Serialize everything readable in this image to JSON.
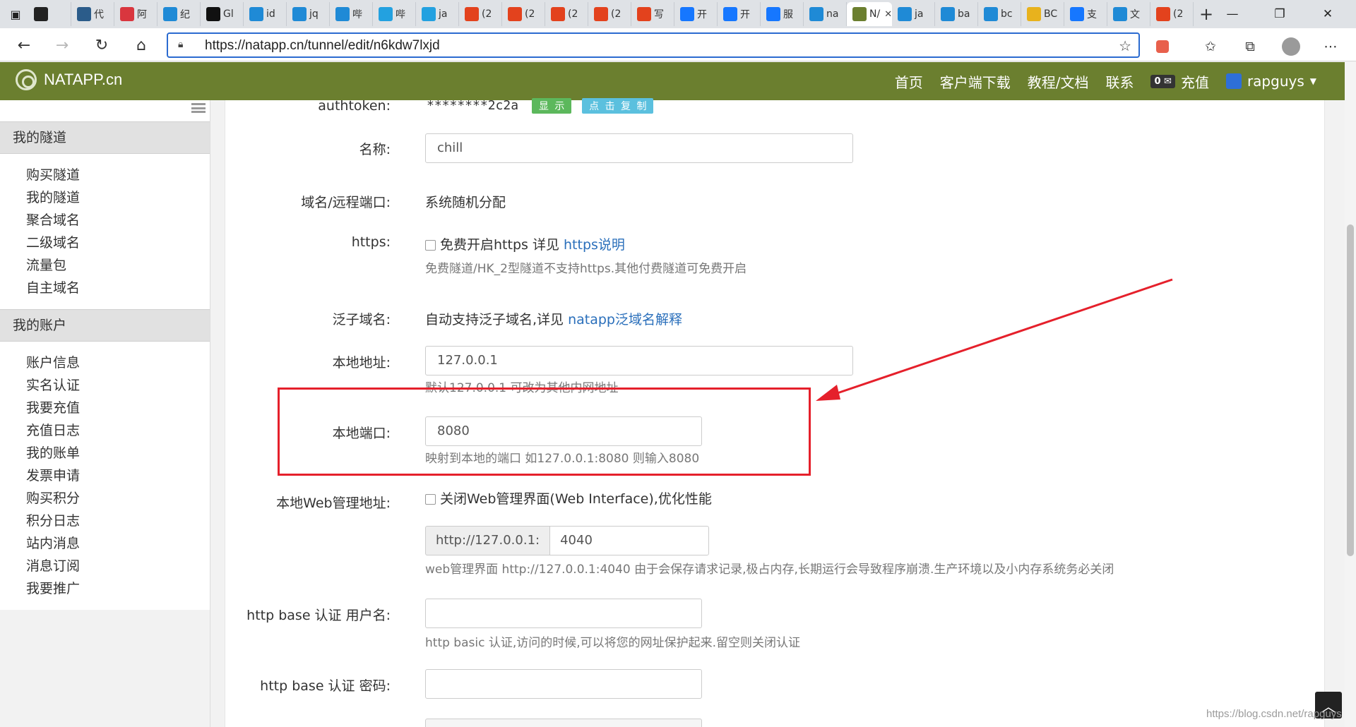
{
  "browser": {
    "tabs": [
      {
        "icon": "edge-icon",
        "label": "",
        "color": "#222222"
      },
      {
        "icon": "bird-icon",
        "label": "代",
        "color": "#2b5c8a"
      },
      {
        "icon": "pdf-icon",
        "label": "阿",
        "color": "#d9363e"
      },
      {
        "icon": "bing-icon",
        "label": "纪",
        "color": "#1f8ad6"
      },
      {
        "icon": "windows-icon",
        "label": "Gl",
        "color": "#111111"
      },
      {
        "icon": "bing-icon",
        "label": "id",
        "color": "#1f8ad6"
      },
      {
        "icon": "bing-icon",
        "label": "jq",
        "color": "#1f8ad6"
      },
      {
        "icon": "bing-icon",
        "label": "哔",
        "color": "#1f8ad6"
      },
      {
        "icon": "bilibili-icon",
        "label": "哔",
        "color": "#23a1e0"
      },
      {
        "icon": "bilibili-icon",
        "label": "ja",
        "color": "#23a1e0"
      },
      {
        "icon": "csdn-icon",
        "label": "(2",
        "color": "#e3421d"
      },
      {
        "icon": "csdn-icon",
        "label": "(2",
        "color": "#e3421d"
      },
      {
        "icon": "csdn-icon",
        "label": "(2",
        "color": "#e3421d"
      },
      {
        "icon": "csdn-icon",
        "label": "(2",
        "color": "#e3421d"
      },
      {
        "icon": "csdn-icon",
        "label": "写",
        "color": "#e3421d"
      },
      {
        "icon": "alipay-icon",
        "label": "开",
        "color": "#1677ff"
      },
      {
        "icon": "alipay-icon",
        "label": "开",
        "color": "#1677ff"
      },
      {
        "icon": "alipay-icon",
        "label": "服",
        "color": "#1677ff"
      },
      {
        "icon": "bing-icon",
        "label": "na",
        "color": "#1f8ad6"
      },
      {
        "icon": "natapp-icon",
        "label": "N/",
        "color": "#6b7f2f",
        "active": true
      },
      {
        "icon": "bing-icon",
        "label": "ja",
        "color": "#1f8ad6"
      },
      {
        "icon": "bing-icon",
        "label": "ba",
        "color": "#1f8ad6"
      },
      {
        "icon": "bing-icon",
        "label": "bc",
        "color": "#1f8ad6"
      },
      {
        "icon": "chrome-icon",
        "label": "BC",
        "color": "#e8b21d"
      },
      {
        "icon": "alipay-icon",
        "label": "支",
        "color": "#1677ff"
      },
      {
        "icon": "bing-icon",
        "label": "文",
        "color": "#1f8ad6"
      },
      {
        "icon": "csdn-icon",
        "label": "(2",
        "color": "#e3421d"
      }
    ],
    "url": "https://natapp.cn/tunnel/edit/n6kdw7lxjd"
  },
  "site": {
    "brand": "NATAPP.cn",
    "nav": [
      "首页",
      "客户端下载",
      "教程/文档",
      "联系"
    ],
    "balance_count": "0",
    "recharge": "充值",
    "username": "rapguys"
  },
  "sidebar": {
    "groups": [
      {
        "title": "我的隧道",
        "items": [
          "购买隧道",
          "我的隧道",
          "聚合域名",
          "二级域名",
          "流量包",
          "自主域名"
        ]
      },
      {
        "title": "我的账户",
        "items": [
          "账户信息",
          "实名认证",
          "我要充值",
          "充值日志",
          "我的账单",
          "发票申请",
          "购买积分",
          "积分日志",
          "站内消息",
          "消息订阅",
          "我要推广"
        ]
      }
    ]
  },
  "form": {
    "authtoken_label": "authtoken:",
    "authtoken_value": "********2c2a",
    "show_btn": "显 示",
    "copy_btn": "点 击 复 制",
    "name_label": "名称:",
    "name_value": "chill",
    "domain_label": "域名/远程端口:",
    "domain_value": "系统随机分配",
    "https_label": "https:",
    "https_check": "免费开启https 详见",
    "https_link": "https说明",
    "https_help": "免费隧道/HK_2型隧道不支持https.其他付费隧道可免费开启",
    "wildcard_label": "泛子域名:",
    "wildcard_text": "自动支持泛子域名,详见",
    "wildcard_link": "natapp泛域名解释",
    "local_addr_label": "本地地址:",
    "local_addr_value": "127.0.0.1",
    "local_addr_help": "默认127.0.0.1 可改为其他内网地址",
    "local_port_label": "本地端口:",
    "local_port_value": "8080",
    "local_port_help": "映射到本地的端口 如127.0.0.1:8080 则输入8080",
    "web_label": "本地Web管理地址:",
    "web_check": "关闭Web管理界面(Web Interface),优化性能",
    "web_prefix": "http://127.0.0.1:",
    "web_port": "4040",
    "web_help": "web管理界面 http://127.0.0.1:4040 由于会保存请求记录,极占内存,长期运行会导致程序崩溃.生产环境以及小内存系统务必关闭",
    "auth_user_label": "http base 认证 用户名:",
    "auth_user_help": "http basic 认证,访问的时候,可以将您的网址保护起来.留空则关闭认证",
    "auth_pass_label": "http base 认证 密码:"
  },
  "watermark": "https://blog.csdn.net/rapguys",
  "colors": {
    "nav_green": "#6b7f2f",
    "highlight_red": "#e5202b",
    "link_blue": "#2a6fbb",
    "show_btn": "#5cb85c",
    "copy_btn": "#5bc0de"
  }
}
